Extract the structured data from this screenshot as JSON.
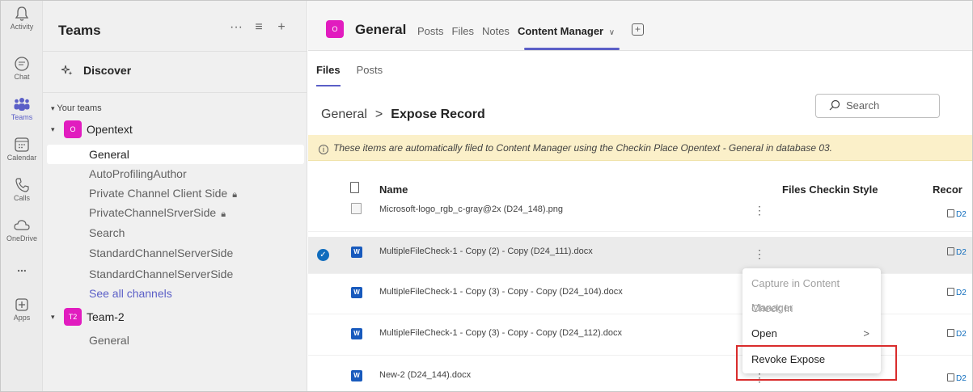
{
  "rail": {
    "items": [
      {
        "label": "Activity",
        "icon": "bell-icon"
      },
      {
        "label": "Chat",
        "icon": "chat-icon"
      },
      {
        "label": "Teams",
        "icon": "teams-icon",
        "active": true
      },
      {
        "label": "Calendar",
        "icon": "calendar-icon"
      },
      {
        "label": "Calls",
        "icon": "phone-icon"
      },
      {
        "label": "OneDrive",
        "icon": "cloud-icon"
      },
      {
        "label": "...",
        "icon": "more-icon"
      },
      {
        "label": "Apps",
        "icon": "apps-plus-icon"
      }
    ]
  },
  "teams_panel": {
    "title": "Teams",
    "actions": {
      "more": "···",
      "filter": "≡",
      "add": "+"
    },
    "discover": "Discover",
    "your_teams": "Your teams",
    "teams": [
      {
        "avatar": "O",
        "name": "Opentext",
        "channels": [
          "General",
          "AutoProfilingAuthor",
          "Private Channel Client Side",
          "PrivateChannelSrverSide",
          "Search",
          "StandardChannelServerSide",
          "StandardChannelServerSide"
        ],
        "see_all": "See all channels"
      },
      {
        "avatar": "T2",
        "name": "Team-2",
        "channels": [
          "General"
        ]
      }
    ]
  },
  "channel_header": {
    "avatar": "O",
    "title": "General",
    "tabs": [
      "Posts",
      "Files",
      "Notes",
      "Content Manager"
    ],
    "active_tab": "Content Manager",
    "dropdown": "∨",
    "add_tab": "+"
  },
  "subtabs": [
    "Files",
    "Posts"
  ],
  "breadcrumb": {
    "root": "General",
    "sep": ">",
    "current": "Expose Record"
  },
  "search": {
    "placeholder": "Search"
  },
  "banner": {
    "text": "These items are automatically filed to Content Manager using the Checkin Place Opentext - General in database 03."
  },
  "table": {
    "columns": {
      "name": "Name",
      "style": "Files Checkin Style",
      "record": "Recor"
    },
    "rows": [
      {
        "name": "Microsoft-logo_rgb_c-gray@2x (D24_148).png",
        "type": "image",
        "record": "D2"
      },
      {
        "name": "MultipleFileCheck-1 - Copy (2) - Copy (D24_111).docx",
        "type": "word",
        "record": "D2",
        "selected": true
      },
      {
        "name": "MultipleFileCheck-1 - Copy (3) - Copy - Copy (D24_104).docx",
        "type": "word",
        "record": "D2"
      },
      {
        "name": "MultipleFileCheck-1 - Copy (3) - Copy - Copy (D24_112).docx",
        "type": "word",
        "record": "D2"
      },
      {
        "name": "New-2 (D24_144).docx",
        "type": "word",
        "record": "D2"
      }
    ]
  },
  "context_menu": {
    "items": [
      {
        "label": "Capture in Content Manager",
        "disabled": true
      },
      {
        "label": "Check In",
        "disabled": true
      },
      {
        "label": "Open",
        "submenu": ">"
      },
      {
        "label": "Revoke Expose",
        "highlighted": true
      }
    ]
  },
  "colors": {
    "brand": "#5b5fc7",
    "team_avatar": "#e11cbf",
    "banner": "#fbf0c9",
    "highlight_box": "#d92c2c",
    "word_blue": "#185abd"
  }
}
